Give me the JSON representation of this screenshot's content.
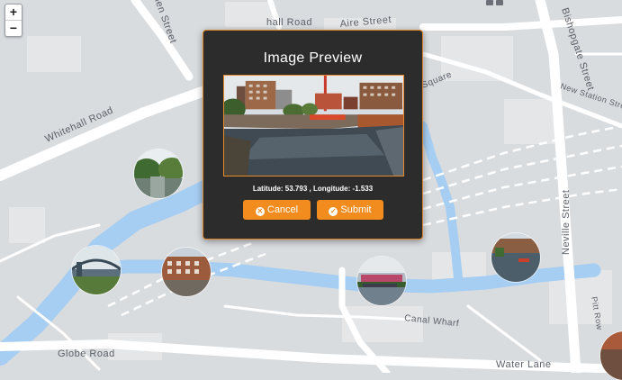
{
  "map": {
    "streets": {
      "whitehall_road": "Whitehall Road",
      "street_upper": "ien Street",
      "hall_road": "hall Road",
      "aire_street": "Aire Street",
      "bishopgate_street": "Bishopgate Street",
      "new_station_street": "New Station Street",
      "square": "Square",
      "neville_street": "Neville Street",
      "pitt_row": "Pitt Row",
      "globe_road": "Globe Road",
      "canal_wharf": "Canal Wharf",
      "water_lane": "Water Lane"
    },
    "zoom": {
      "in_label": "+",
      "out_label": "−"
    }
  },
  "modal": {
    "title": "Image Preview",
    "coordinates": "Latitude: 53.793 , Longitude: -1.533",
    "cancel_label": "Cancel",
    "submit_label": "Submit"
  },
  "colors": {
    "water": "#a6cdf2",
    "land": "#d9dcdf",
    "road": "#ffffff",
    "accent": "#f28c1e",
    "modal_bg": "#2c2c2c"
  },
  "icons": {
    "cancel": "times-circle-icon",
    "submit": "check-circle-icon"
  }
}
